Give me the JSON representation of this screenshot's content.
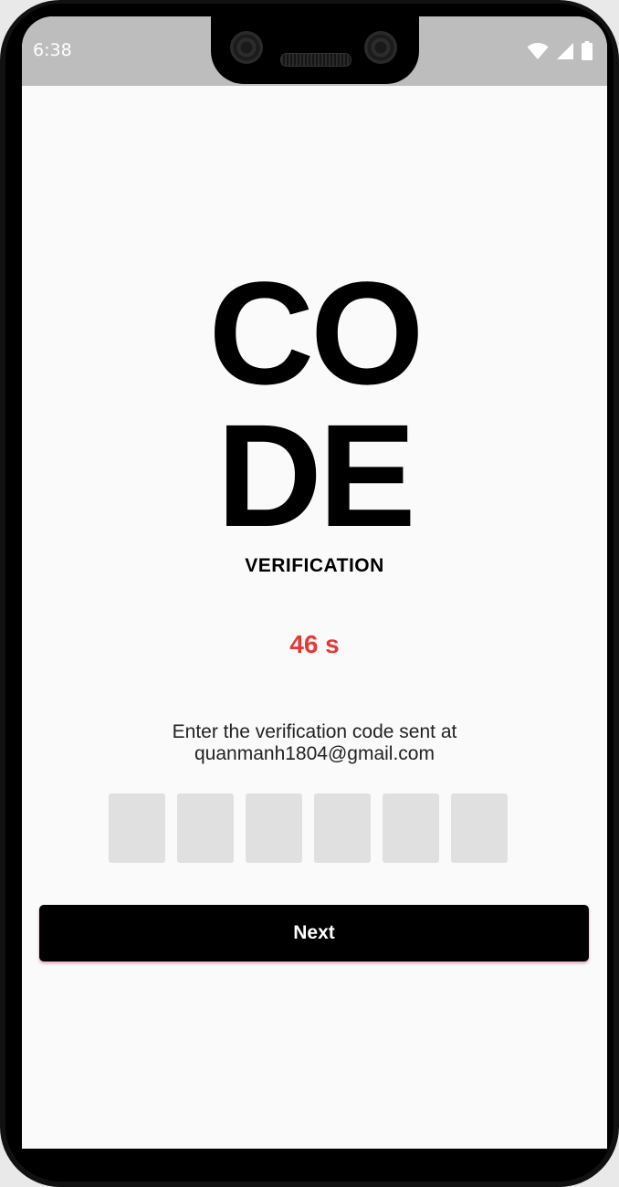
{
  "status_bar": {
    "time": "6:38",
    "icons": [
      "wifi-icon",
      "cellular-signal-icon",
      "battery-icon"
    ]
  },
  "header": {
    "title_line1": "CO",
    "title_line2": "DE",
    "subtitle": "VERIFICATION"
  },
  "timer": {
    "text": "46 s",
    "color": "#e53935"
  },
  "instruction": {
    "line1": "Enter the verification code sent at",
    "email": "quanmanh1804@gmail.com"
  },
  "otp": {
    "digits": [
      "",
      "",
      "",
      "",
      "",
      ""
    ]
  },
  "actions": {
    "next_label": "Next"
  },
  "colors": {
    "background": "#fafafa",
    "status_bar": "#bdbdbd",
    "otp_box": "#e0e0e0",
    "button": "#000000"
  }
}
